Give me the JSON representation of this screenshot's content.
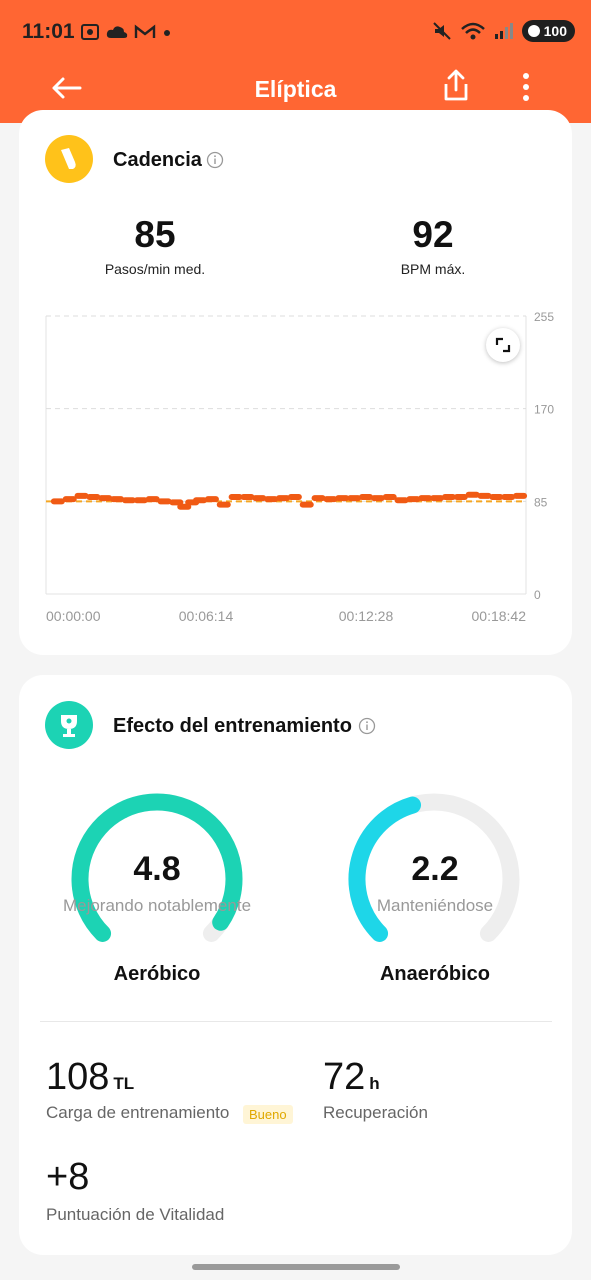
{
  "status_bar": {
    "time": "11:01",
    "battery": "100"
  },
  "app_bar": {
    "title": "Elíptica"
  },
  "cadence": {
    "title": "Cadencia",
    "avg_value": "85",
    "avg_label": "Pasos/min med.",
    "max_value": "92",
    "max_label": "BPM máx."
  },
  "chart_data": {
    "type": "line",
    "x_labels": [
      "00:00:00",
      "00:06:14",
      "00:12:28",
      "00:18:42"
    ],
    "y_ticks": [
      "255",
      "170",
      "85",
      "0"
    ],
    "ylim": [
      0,
      255
    ],
    "xlim_seconds": [
      0,
      1215
    ],
    "reference_line": 85,
    "series": [
      {
        "color": "#f05a14",
        "x": [
          30,
          60,
          90,
          120,
          150,
          180,
          210,
          240,
          270,
          300,
          330,
          350,
          370,
          390,
          420,
          450,
          480,
          510,
          540,
          570,
          600,
          630,
          660,
          690,
          720,
          750,
          780,
          810,
          840,
          870,
          900,
          930,
          960,
          990,
          1020,
          1050,
          1080,
          1110,
          1140,
          1170,
          1200
        ],
        "y": [
          85,
          87,
          90,
          89,
          88,
          87,
          86,
          86,
          87,
          85,
          84,
          80,
          84,
          86,
          87,
          82,
          89,
          89,
          88,
          87,
          88,
          89,
          82,
          88,
          87,
          88,
          88,
          89,
          88,
          89,
          86,
          87,
          88,
          88,
          89,
          89,
          91,
          90,
          89,
          89,
          90
        ]
      }
    ]
  },
  "training": {
    "title": "Efecto del entrenamiento",
    "aerobic_value": "4.8",
    "aerobic_fraction": 0.96,
    "aerobic_sub": "Mejorando notablemente",
    "aerobic_label": "Aeróbico",
    "aerobic_color": "#1cd3b4",
    "anaerobic_value": "2.2",
    "anaerobic_fraction": 0.44,
    "anaerobic_sub": "Manteniéndose",
    "anaerobic_label": "Anaeróbico",
    "anaerobic_color": "#1ed6e8",
    "load_value": "108",
    "load_unit": "TL",
    "load_label": "Carga de entrenamiento",
    "load_badge": "Bueno",
    "recovery_value": "72",
    "recovery_unit": "h",
    "recovery_label": "Recuperación",
    "vitality_value": "+8",
    "vitality_label": "Puntuación de Vitalidad"
  },
  "colors": {
    "accent": "#ff6633",
    "cadence_icon": "#ffc21a",
    "trophy_icon": "#1cd3b4"
  }
}
